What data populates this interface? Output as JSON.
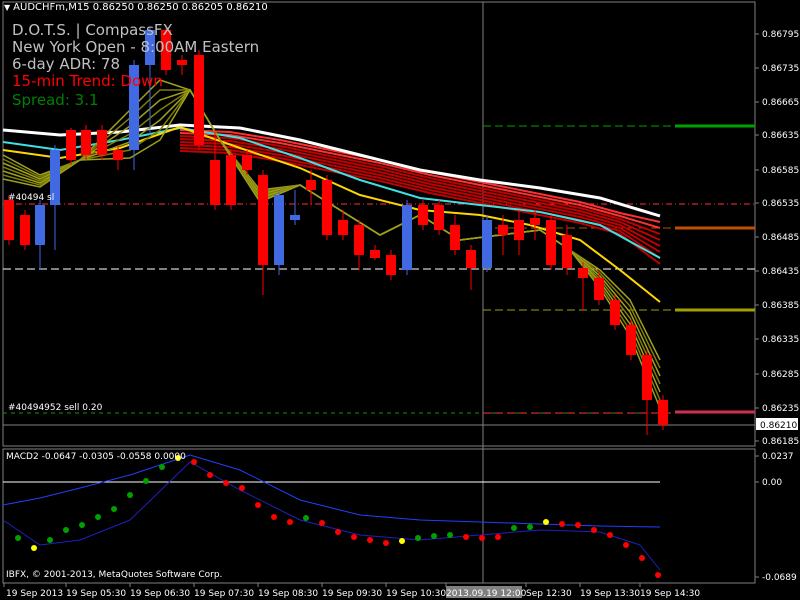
{
  "header": {
    "symbol": "AUDCHFm,M15",
    "ohlc": "0.86250 0.86250 0.86205 0.86210"
  },
  "info": {
    "line1": "D.O.T.S. | CompassFX",
    "line2": "New York Open - 8:00AM Eastern",
    "line3": "6-day ADR: 78",
    "line4": "15-min Trend: Down",
    "line5": "Spread: 3.1"
  },
  "orders": {
    "sl_label": "#40494 sl",
    "sell_label": "#40494952 sell 0.20"
  },
  "macd": {
    "title": "MACD2 -0.0647 -0.0305 -0.0558 0.0000",
    "scale": [
      "0.0237",
      "0.00",
      "-0.0689"
    ]
  },
  "copyright": "IBFX, © 2001-2013, MetaQuotes Software Corp.",
  "price_scale": [
    "0.86795",
    "0.86735",
    "0.86665",
    "0.86635",
    "0.86585",
    "0.86535",
    "0.86485",
    "0.86435",
    "0.86385",
    "0.86335",
    "0.86285",
    "0.86235",
    "0.86210",
    "0.86185"
  ],
  "current_price": "0.86210",
  "time_axis": [
    "19 Sep 2013",
    "19 Sep 05:30",
    "19 Sep 06:30",
    "19 Sep 07:30",
    "19 Sep 08:30",
    "19 Sep 09:30",
    "19 Sep 10:30",
    "2013.09.19 12:00",
    "Sep 12:30",
    "19 Sep 13:30",
    "19 Sep 14:30"
  ],
  "colors": {
    "bull": "#4169e1",
    "bear": "#ff0000",
    "info_white": "#c0c0c0",
    "trend_down": "#ff0000",
    "spread": "#008000"
  }
}
